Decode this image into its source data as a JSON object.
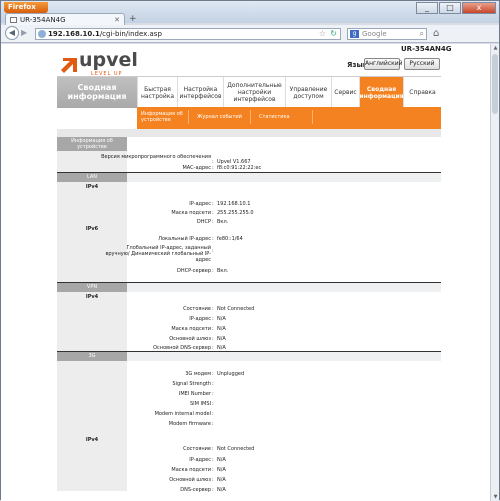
{
  "browser": {
    "app_button": "Firefox",
    "tab_title": "UR-354AN4G",
    "new_tab": "+",
    "url_host": "192.168.10.1",
    "url_path": "/cgi-bin/index.asp",
    "search_placeholder": "Google",
    "window_controls": [
      "_",
      "□",
      "x"
    ]
  },
  "header": {
    "model": "UR-354AN4G",
    "logo": "upvel",
    "logo_sub": "LEVEL UP",
    "lang_label": "Язык",
    "lang_en": "Английский",
    "lang_ru": "Русский"
  },
  "nav": {
    "home": "Сводная информация",
    "items": [
      "Быстрая настройка",
      "Настройка интерфейсов",
      "Дополнительные настройки интерфейсов",
      "Управление доступом",
      "Сервис",
      "Сводная информация",
      "Справка"
    ]
  },
  "subnav": [
    "Информация об устройстве",
    "Журнал событий",
    "Статистика"
  ],
  "device": {
    "section": "Информация об устройстве",
    "rows": [
      {
        "label": "Версия микропрограммного обеспечения",
        "value": "Upvel V1.667"
      },
      {
        "label": "МАС-адрес",
        "value": "f8:c0:91:22:22:ec"
      }
    ]
  },
  "lan": {
    "section": "LAN",
    "ipv4_label": "IPv4",
    "ipv4_rows": [
      {
        "label": "IP-адрес",
        "value": "192.168.10.1"
      },
      {
        "label": "Маска подсети",
        "value": "255.255.255.0"
      },
      {
        "label": "DHCP",
        "value": "Вкл."
      }
    ],
    "ipv6_label": "IPv6",
    "ipv6_rows": [
      {
        "label": "Локальный IP-адрес",
        "value": "fe80::1/64"
      },
      {
        "label": "Глобальный IP-адрес, заданный вручную/ Динамический глобальный IP-адрес",
        "value": ""
      },
      {
        "label": "DHCP-сервер",
        "value": "Вкл."
      }
    ]
  },
  "vpn": {
    "section": "VPN",
    "ipv4_label": "IPv4",
    "rows": [
      {
        "label": "Состояние",
        "value": "Not Connected"
      },
      {
        "label": "IP-адрес",
        "value": "N/A"
      },
      {
        "label": "Маска подсети",
        "value": "N/A"
      },
      {
        "label": "Основной шлюз",
        "value": "N/A"
      },
      {
        "label": "Основной DNS-сервер",
        "value": "N/A"
      }
    ]
  },
  "g3": {
    "section": "3G",
    "rows": [
      {
        "label": "3G модем",
        "value": "Unplugged"
      },
      {
        "label": "Signal Strength",
        "value": ""
      },
      {
        "label": "IMEI Number",
        "value": ""
      },
      {
        "label": "SIM IMSI",
        "value": ""
      },
      {
        "label": "Modem internal model",
        "value": ""
      },
      {
        "label": "Modem firmware",
        "value": ""
      }
    ],
    "ipv4_label": "IPv4",
    "ipv4_rows": [
      {
        "label": "Состояние",
        "value": "Not Connected"
      },
      {
        "label": "IP-адрес",
        "value": "N/A"
      },
      {
        "label": "Маска подсети",
        "value": "N/A"
      },
      {
        "label": "Основной шлюз",
        "value": "N/A"
      },
      {
        "label": "DNS-сервер",
        "value": "N/A"
      }
    ]
  }
}
